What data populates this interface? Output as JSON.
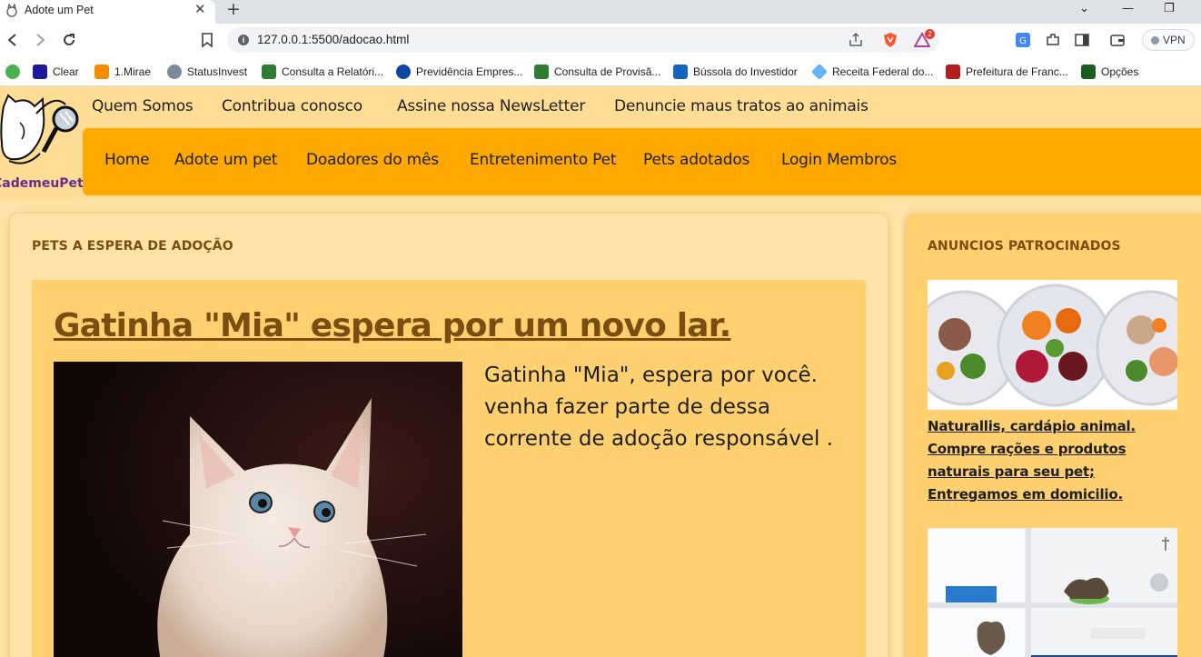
{
  "browser": {
    "tab_title": "Adote um Pet",
    "tab_close": "✕",
    "new_tab": "+",
    "url": "127.0.0.1:5500/adocao.html",
    "vpn_label": "VPN",
    "brave_badge_count": "2",
    "window_controls": {
      "dropdown": "⌄",
      "minimize": "—",
      "restore": "❐"
    },
    "bookmarks": [
      {
        "label": "",
        "icon": "v-green-icon",
        "color": "#4caf50"
      },
      {
        "label": "Clear",
        "icon": "clear-icon",
        "color": "#1a1a9a"
      },
      {
        "label": "1.Mirae",
        "icon": "mirae-icon",
        "color": "#f28c00"
      },
      {
        "label": "StatusInvest",
        "icon": "statusinvest-icon",
        "color": "#7a8a9a"
      },
      {
        "label": "Consulta a Relatóri...",
        "icon": "gov-icon",
        "color": "#2e7d32"
      },
      {
        "label": "Previdência Empres...",
        "icon": "circle-icon",
        "color": "#0d47a1"
      },
      {
        "label": "Consulta de Provisã...",
        "icon": "gov-icon",
        "color": "#2e7d32"
      },
      {
        "label": "Bússola do Investidor",
        "icon": "b-icon",
        "color": "#1565c0"
      },
      {
        "label": "Receita Federal do...",
        "icon": "diamond-icon",
        "color": "#64b5f6"
      },
      {
        "label": "Prefeitura de Franc...",
        "icon": "crest-icon",
        "color": "#b71c1c"
      },
      {
        "label": "Opções",
        "icon": "chart-icon",
        "color": "#1b5e20"
      }
    ]
  },
  "site": {
    "logo_text": "CademeuPet",
    "top_nav": [
      "Quem Somos",
      "Contribua conosco",
      "Assine nossa NewsLetter",
      "Denuncie maus tratos ao animais"
    ],
    "main_nav": [
      "Home",
      "Adote um pet",
      "Doadores do mês",
      "Entretenimento Pet",
      "Pets adotados",
      "Login Membros"
    ]
  },
  "main": {
    "section_title": "PETS A ESPERA DE ADOÇÃO",
    "post": {
      "title": "Gatinha \"Mia\" espera por um novo lar.",
      "text": "Gatinha \"Mia\", espera por você. venha fazer parte de dessa corrente de adoção responsável ."
    }
  },
  "sidebar": {
    "section_title": "ANUNCIOS PATROCINADOS",
    "ad1_caption": "Naturallis, cardápio animal. Compre rações e produtos naturais para seu pet; Entregamos em domicilio."
  },
  "colors": {
    "page_bg": "#ffe3a6",
    "header_bg": "#ffdd95",
    "nav_bg": "#ffa800",
    "card_bg": "#ffd070",
    "title_brown": "#7a4e10",
    "logo_purple": "#6a2c8c"
  }
}
